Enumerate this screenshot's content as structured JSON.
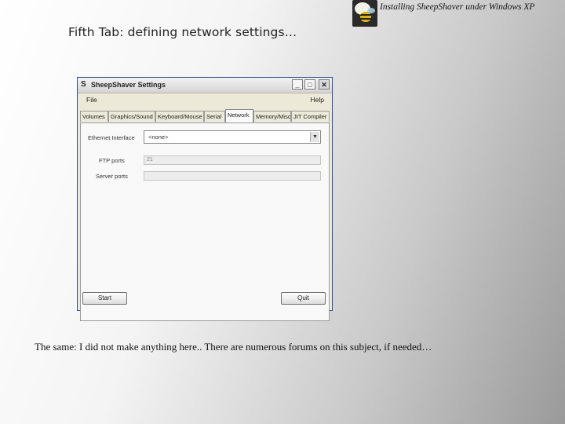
{
  "header": {
    "title": "Installing SheepShaver under Windows XP"
  },
  "slide": {
    "title": "Fifth Tab: defining network settings…",
    "caption": "The same: I did not make anything here.. There are numerous forums on this subject, if needed…"
  },
  "window": {
    "title": "SheepShaver Settings",
    "menu": {
      "file": "File",
      "help": "Help"
    },
    "controls": {
      "minimize": "_",
      "maximize": "□",
      "close": "✕"
    },
    "tabs": [
      "Volumes",
      "Graphics/Sound",
      "Keyboard/Mouse",
      "Serial",
      "Network",
      "Memory/Misc",
      "JIT Compiler"
    ],
    "active_tab": "Network",
    "network": {
      "ethernet_label": "Ethernet Interface",
      "ethernet_value": "<none>",
      "ftp_label": "FTP ports",
      "ftp_value": "21",
      "server_label": "Server ports",
      "server_value": ""
    },
    "buttons": {
      "start": "Start",
      "quit": "Quit"
    }
  }
}
